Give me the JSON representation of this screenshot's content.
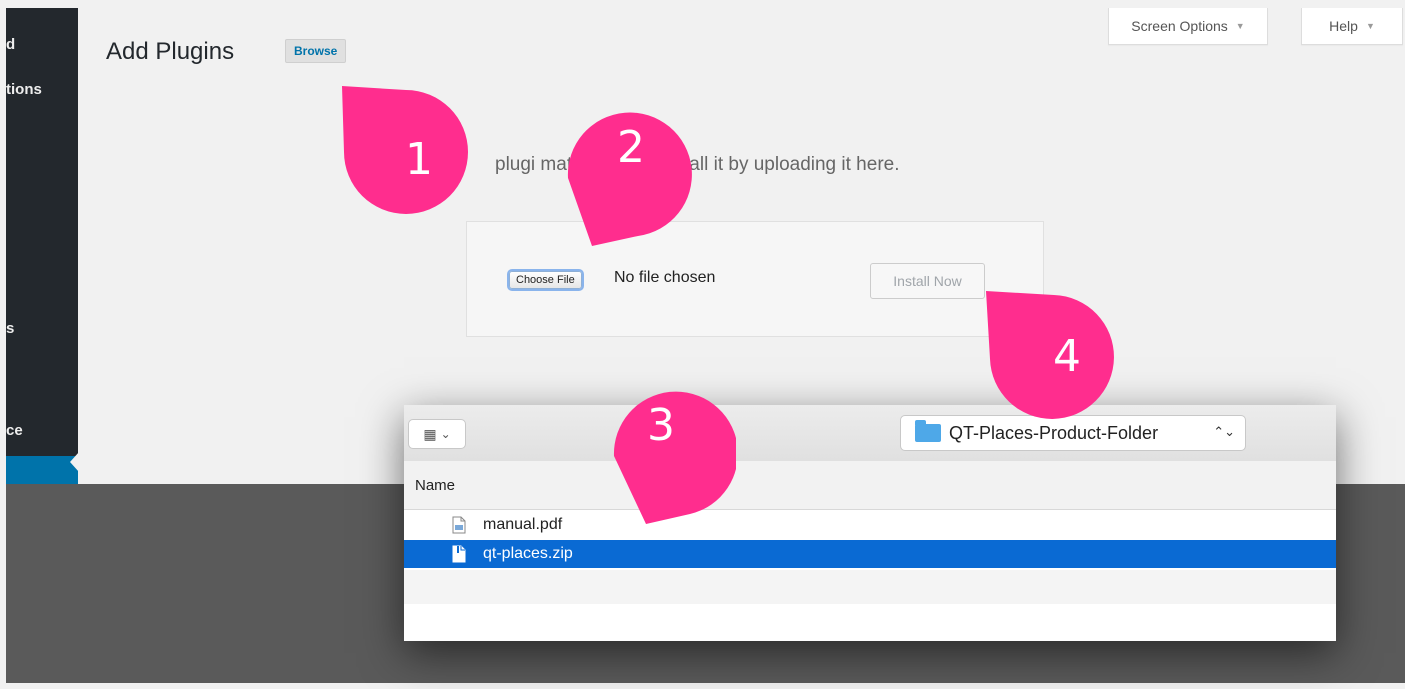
{
  "sidebar": {
    "items": [
      {
        "label": "d"
      },
      {
        "label": "tions"
      },
      {
        "label": "s"
      },
      {
        "label": "ce"
      }
    ]
  },
  "header": {
    "title": "Add Plugins",
    "browse_label": "Browse",
    "screen_options_label": "Screen Options",
    "help_label": "Help",
    "dropdown_arrow": "▼"
  },
  "upload": {
    "description": "plugi                    mat, you may install it by uploading it here.",
    "choose_file_label": "Choose File",
    "no_file_text": "No file chosen",
    "install_label": "Install Now"
  },
  "file_dialog": {
    "view_icon_glyph": "▦",
    "view_chevron": "⌄",
    "folder_name": "QT-Places-Product-Folder",
    "folder_chevron": "⌃⌄",
    "column_header": "Name",
    "files": [
      {
        "name": "manual.pdf",
        "icon": "pdf-file-icon",
        "selected": false
      },
      {
        "name": "qt-places.zip",
        "icon": "zip-file-icon",
        "selected": true
      }
    ]
  },
  "annotations": [
    {
      "number": "1"
    },
    {
      "number": "2"
    },
    {
      "number": "3"
    },
    {
      "number": "4"
    }
  ],
  "colors": {
    "marker": "#ff2d8e",
    "selection": "#0a6ad3",
    "sidebar": "#23282d",
    "wp_blue": "#0073aa"
  }
}
